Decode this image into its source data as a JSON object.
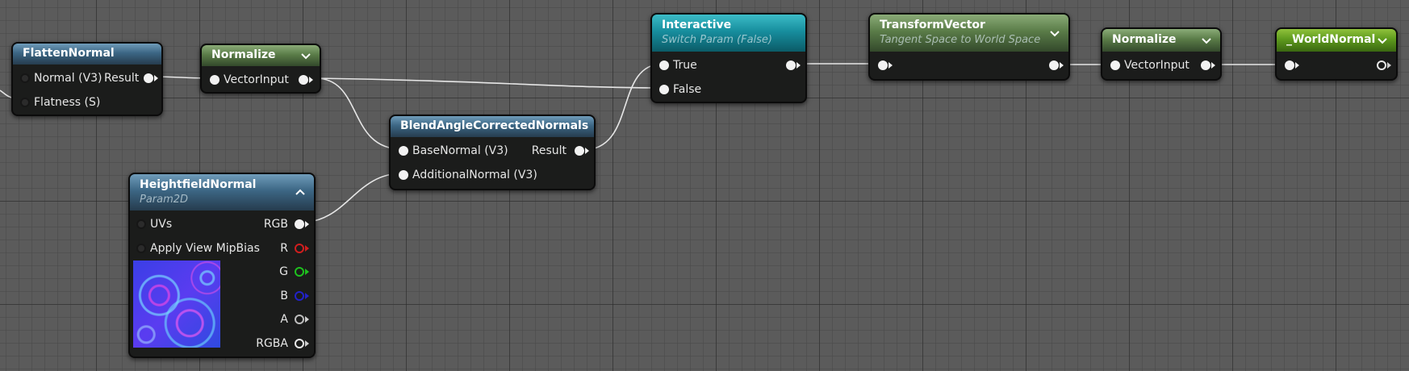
{
  "graph": {
    "flatten_normal": {
      "title": "FlattenNormal",
      "inputs": [
        "Normal (V3)",
        "Flatness (S)"
      ],
      "output": "Result"
    },
    "normalize_1": {
      "title": "Normalize",
      "input": "VectorInput"
    },
    "heightfield_normal": {
      "title": "HeightfieldNormal",
      "subtitle": "Param2D",
      "inputs": [
        "UVs",
        "Apply View MipBias"
      ],
      "outputs": [
        "RGB",
        "R",
        "G",
        "B",
        "A",
        "RGBA"
      ],
      "output_colors": {
        "RGB": "#f2f2f2",
        "R": "#d01e1e",
        "G": "#1ec01e",
        "B": "#2222c8",
        "A": "#cfcfcf",
        "RGBA": "#e8e8e8"
      }
    },
    "blend_normals": {
      "title": "BlendAngleCorrectedNormals",
      "inputs": [
        "BaseNormal (V3)",
        "AdditionalNormal (V3)"
      ],
      "output": "Result"
    },
    "interactive": {
      "title": "Interactive",
      "subtitle": "Switch Param (False)",
      "inputs": [
        "True",
        "False"
      ]
    },
    "transform_vector": {
      "title": "TransformVector",
      "subtitle": "Tangent Space to World Space"
    },
    "normalize_2": {
      "title": "Normalize",
      "input": "VectorInput"
    },
    "world_normal": {
      "title": "_WorldNormal"
    }
  },
  "colors": {
    "canvas": "#5b5b5b",
    "node_body": "#1b1c1b",
    "header_function": "#3c6684",
    "header_math": "#5a7c48",
    "header_switch": "#178e9e",
    "header_output": "#5e9a1d",
    "wire": "#e8e8e8"
  },
  "icons": [
    "chevron-down-icon",
    "chevron-up-icon",
    "pin-connected-icon",
    "pin-disconnected-icon"
  ]
}
